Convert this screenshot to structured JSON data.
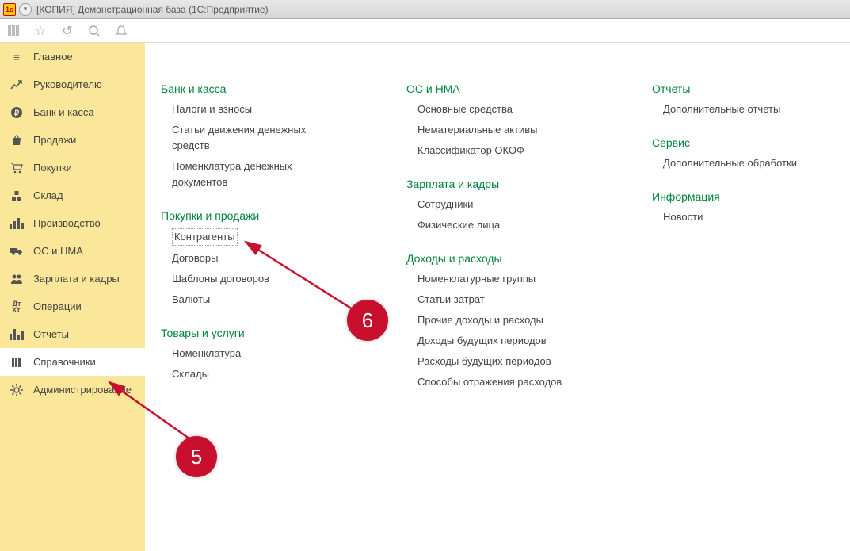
{
  "titlebar": {
    "title": "[КОПИЯ] Демонстрационная база  (1С:Предприятие)"
  },
  "sidebar": {
    "items": [
      {
        "label": "Главное"
      },
      {
        "label": "Руководителю"
      },
      {
        "label": "Банк и касса"
      },
      {
        "label": "Продажи"
      },
      {
        "label": "Покупки"
      },
      {
        "label": "Склад"
      },
      {
        "label": "Производство"
      },
      {
        "label": "ОС и НМА"
      },
      {
        "label": "Зарплата и кадры"
      },
      {
        "label": "Операции"
      },
      {
        "label": "Отчеты"
      },
      {
        "label": "Справочники"
      },
      {
        "label": "Администрирование"
      }
    ]
  },
  "columns": {
    "col1": {
      "sec1": {
        "title": "Банк и касса",
        "items": [
          "Налоги и взносы",
          "Статьи движения денежных средств",
          "Номенклатура денежных документов"
        ]
      },
      "sec2": {
        "title": "Покупки и продажи",
        "items": [
          "Контрагенты",
          "Договоры",
          "Шаблоны договоров",
          "Валюты"
        ]
      },
      "sec3": {
        "title": "Товары и услуги",
        "items": [
          "Номенклатура",
          "Склады"
        ]
      }
    },
    "col2": {
      "sec1": {
        "title": "ОС и НМА",
        "items": [
          "Основные средства",
          "Нематериальные активы",
          "Классификатор ОКОФ"
        ]
      },
      "sec2": {
        "title": "Зарплата и кадры",
        "items": [
          "Сотрудники",
          "Физические лица"
        ]
      },
      "sec3": {
        "title": "Доходы и расходы",
        "items": [
          "Номенклатурные группы",
          "Статьи затрат",
          "Прочие доходы и расходы",
          "Доходы будущих периодов",
          "Расходы будущих периодов",
          "Способы отражения расходов"
        ]
      }
    },
    "col3": {
      "sec1": {
        "title": "Отчеты",
        "items": [
          "Дополнительные отчеты"
        ]
      },
      "sec2": {
        "title": "Сервис",
        "items": [
          "Дополнительные обработки"
        ]
      },
      "sec3": {
        "title": "Информация",
        "items": [
          "Новости"
        ]
      }
    }
  },
  "callouts": {
    "a": "5",
    "b": "6"
  }
}
